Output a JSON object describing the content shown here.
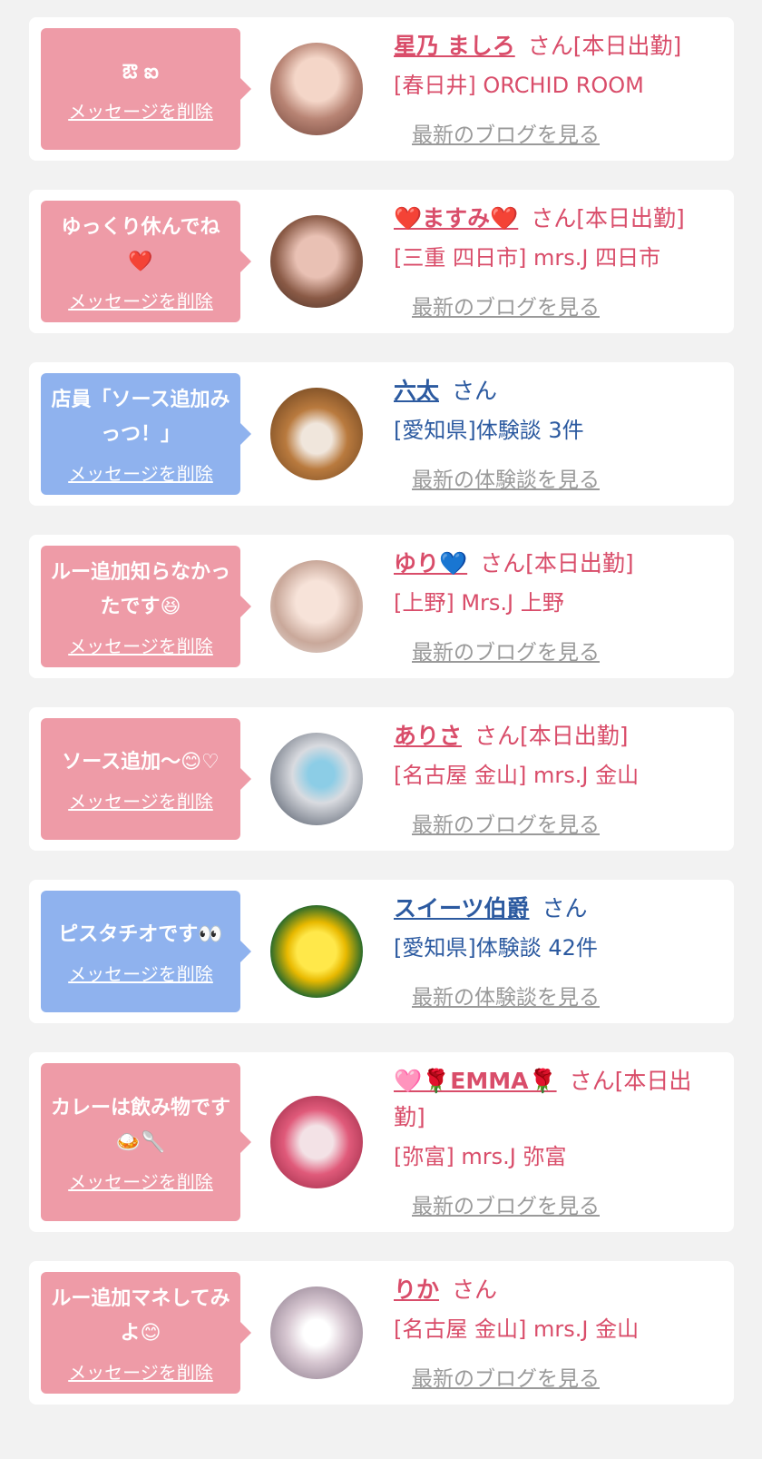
{
  "items": [
    {
      "message": "ఔ ఐ",
      "delete_label": "メッセージを削除",
      "name": "星乃 ましろ",
      "suffix": "さん[本日出勤]",
      "shop": "[春日井] ORCHID ROOM",
      "latest": "最新のブログを見る",
      "bubble_color": "#ee9ba7",
      "accent": "#d94d6a"
    },
    {
      "message": "ゆっくり休んでね❤️",
      "delete_label": "メッセージを削除",
      "name": "❤️ますみ❤️",
      "suffix": "さん[本日出勤]",
      "shop": "[三重 四日市] mrs.J 四日市",
      "latest": "最新のブログを見る",
      "bubble_color": "#ee9ba7",
      "accent": "#d94d6a"
    },
    {
      "message": "店員「ソース追加みっつ！」",
      "delete_label": "メッセージを削除",
      "name": "六太",
      "suffix": "さん",
      "shop": "[愛知県]体験談 3件",
      "latest": "最新の体験談を見る",
      "bubble_color": "#8fb2ee",
      "accent": "#2c5aa0"
    },
    {
      "message": "ルー追加知らなかったです😆",
      "delete_label": "メッセージを削除",
      "name": "ゆり💙",
      "suffix": "さん[本日出勤]",
      "shop": "[上野] Mrs.J 上野",
      "latest": "最新のブログを見る",
      "bubble_color": "#ee9ba7",
      "accent": "#d94d6a"
    },
    {
      "message": "ソース追加〜😊♡",
      "delete_label": "メッセージを削除",
      "name": "ありさ",
      "suffix": "さん[本日出勤]",
      "shop": "[名古屋 金山] mrs.J 金山",
      "latest": "最新のブログを見る",
      "bubble_color": "#ee9ba7",
      "accent": "#d94d6a"
    },
    {
      "message": "ピスタチオです👀",
      "delete_label": "メッセージを削除",
      "name": "スイーツ伯爵",
      "suffix": "さん",
      "shop": "[愛知県]体験談 42件",
      "latest": "最新の体験談を見る",
      "bubble_color": "#8fb2ee",
      "accent": "#2c5aa0"
    },
    {
      "message": "カレーは飲み物です🍛🥄",
      "delete_label": "メッセージを削除",
      "name": "🩷🌹EMMA🌹",
      "suffix": "さん[本日出勤]",
      "shop": "[弥富] mrs.J 弥富",
      "latest": "最新のブログを見る",
      "bubble_color": "#ee9ba7",
      "accent": "#d94d6a"
    },
    {
      "message": "ルー追加マネしてみよ😊",
      "delete_label": "メッセージを削除",
      "name": "りか",
      "suffix": "さん",
      "shop": "[名古屋 金山] mrs.J 金山",
      "latest": "最新のブログを見る",
      "bubble_color": "#ee9ba7",
      "accent": "#d94d6a"
    }
  ]
}
